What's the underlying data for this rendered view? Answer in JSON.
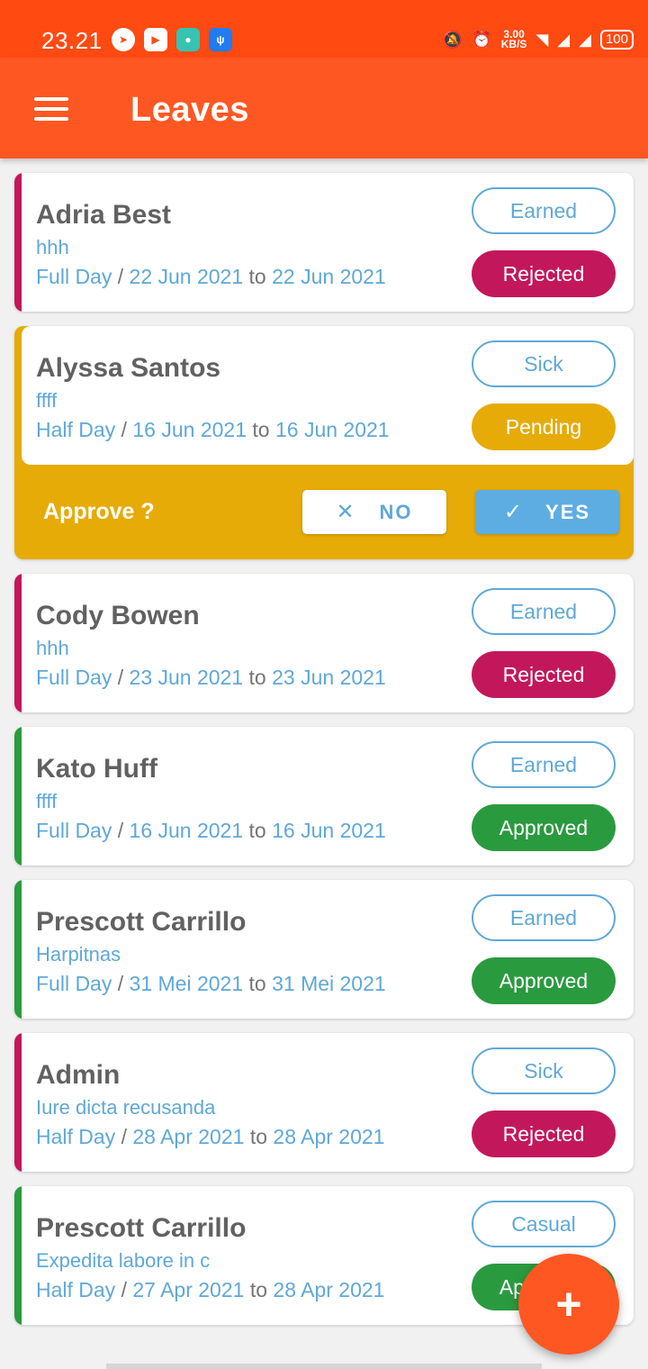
{
  "status_bar": {
    "time": "23.21",
    "speed_value": "3.00",
    "speed_unit": "KB/S",
    "battery": "100"
  },
  "app_bar": {
    "title": "Leaves"
  },
  "colors": {
    "primary": "#ff5722",
    "rejected": "#c2185b",
    "approved": "#2a9a3f",
    "pending": "#e6ab07",
    "link": "#5fa8d8"
  },
  "leaves": [
    {
      "name": "Adria Best",
      "reason": "hhh",
      "duration": "Full Day",
      "from": "22 Jun 2021",
      "to_word": "to",
      "to": "22 Jun 2021",
      "type": "Earned",
      "status": "Rejected"
    },
    {
      "name": "Alyssa Santos",
      "reason": "ffff",
      "duration": "Half Day",
      "from": "16 Jun 2021",
      "to_word": "to",
      "to": "16 Jun 2021",
      "type": "Sick",
      "status": "Pending"
    },
    {
      "name": "Cody Bowen",
      "reason": "hhh",
      "duration": "Full Day",
      "from": "23 Jun 2021",
      "to_word": "to",
      "to": "23 Jun 2021",
      "type": "Earned",
      "status": "Rejected"
    },
    {
      "name": "Kato Huff",
      "reason": "ffff",
      "duration": "Full Day",
      "from": "16 Jun 2021",
      "to_word": "to",
      "to": "16 Jun 2021",
      "type": "Earned",
      "status": "Approved"
    },
    {
      "name": "Prescott Carrillo",
      "reason": "Harpitnas",
      "duration": "Full Day",
      "from": "31 Mei 2021",
      "to_word": "to",
      "to": "31 Mei 2021",
      "type": "Earned",
      "status": "Approved"
    },
    {
      "name": "Admin",
      "reason": "Iure dicta recusanda",
      "duration": "Half Day",
      "from": "28 Apr 2021",
      "to_word": "to",
      "to": "28 Apr 2021",
      "type": "Sick",
      "status": "Rejected"
    },
    {
      "name": "Prescott Carrillo",
      "reason": "Expedita labore in c",
      "duration": "Half Day",
      "from": "27 Apr 2021",
      "to_word": "to",
      "to": "28 Apr 2021",
      "type": "Casual",
      "status": "Approved"
    }
  ],
  "approval": {
    "label": "Approve ?",
    "no_label": "NO",
    "yes_label": "YES"
  },
  "fab": {
    "label": "+"
  }
}
